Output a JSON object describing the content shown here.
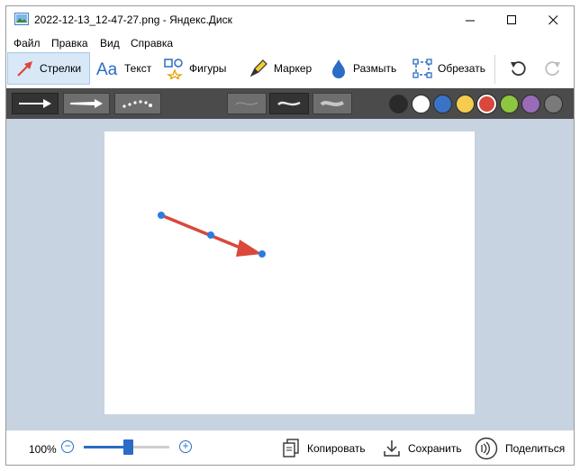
{
  "window": {
    "title": "2022-12-13_12-47-27.png - Яндекс.Диск"
  },
  "menu": [
    "Файл",
    "Правка",
    "Вид",
    "Справка"
  ],
  "tools": [
    {
      "label": "Стрелки",
      "icon": "arrow-icon",
      "active": true
    },
    {
      "label": "Текст",
      "icon": "text-icon",
      "active": false
    },
    {
      "label": "Фигуры",
      "icon": "shapes-icon",
      "active": false
    },
    {
      "label": "Маркер",
      "icon": "marker-icon",
      "active": false
    },
    {
      "label": "Размыть",
      "icon": "blur-drop-icon",
      "active": false
    },
    {
      "label": "Обрезать",
      "icon": "crop-icon",
      "active": false
    }
  ],
  "history": {
    "undo_icon": "undo-icon",
    "redo_icon": "redo-icon",
    "redo_enabled": false
  },
  "arrow_styles": [
    "straight-arrow",
    "bold-arrow",
    "dotted-arrow"
  ],
  "thickness": [
    "thin",
    "medium",
    "thick"
  ],
  "selected_thickness": "medium",
  "palette": [
    "#2a2a2a",
    "#ffffff",
    "#3a73c6",
    "#f5cc50",
    "#d9483b",
    "#8dc63f",
    "#9a6cb8",
    "#7a7a7a"
  ],
  "selected_color": "#d9483b",
  "annotation": {
    "type": "arrow",
    "color": "#d9483b",
    "handle_color": "#2b7be4"
  },
  "status": {
    "zoom": "100%",
    "zoom_level": 0.52,
    "copy_label": "Копировать",
    "save_label": "Сохранить",
    "share_label": "Поделиться"
  },
  "colors": {
    "accent": "#2b6cc4",
    "option_bar": "#4b4b4b",
    "canvas_bg": "#c7d3e0"
  }
}
